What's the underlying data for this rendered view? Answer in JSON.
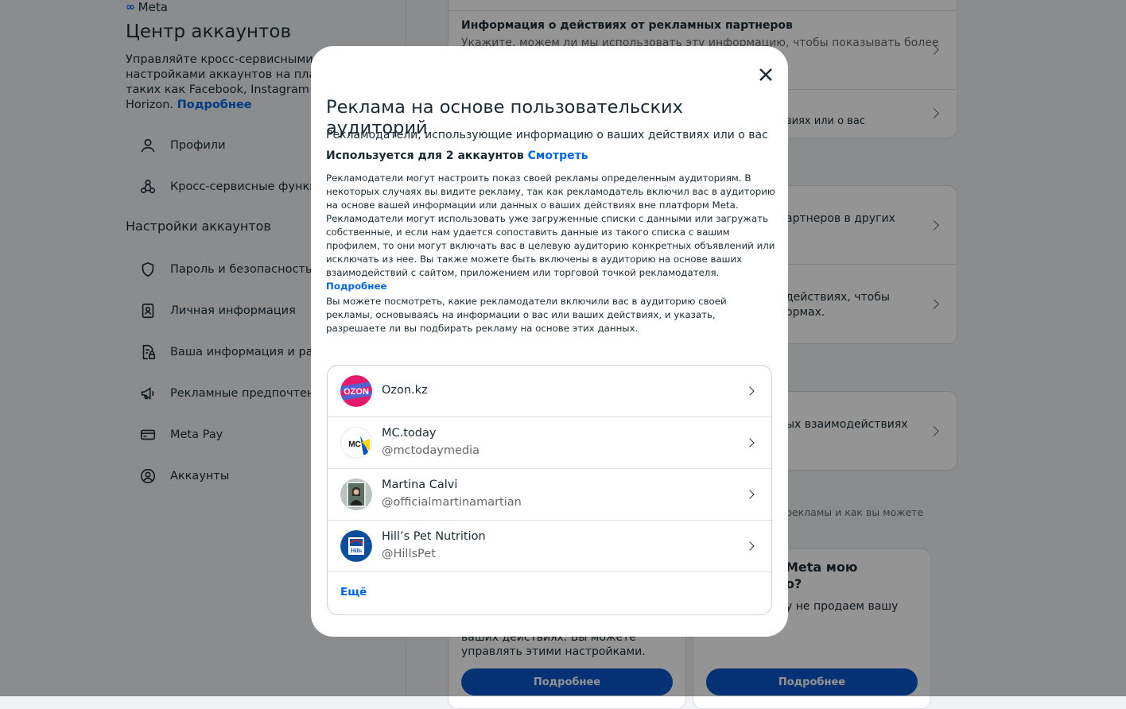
{
  "brand": {
    "name": "Meta"
  },
  "sidebar": {
    "title": "Центр аккаунтов",
    "description": "Управляйте кросс-сервисными фу\nнастройками аккаунтов на платфо\nтаких как Facebook, Instagram и\nHorizon.",
    "description_link": "Подробнее",
    "items_top": [
      {
        "label": "Профили",
        "icon": "person-icon"
      },
      {
        "label": "Кросс-сервисные функц",
        "icon": "connected-experiences-icon"
      }
    ],
    "section_title": "Настройки аккаунтов",
    "items": [
      {
        "label": "Пароль и безопасность",
        "icon": "shield-icon"
      },
      {
        "label": "Личная информация",
        "icon": "id-card-icon"
      },
      {
        "label": "Ваша информация и разр",
        "icon": "document-lock-icon"
      },
      {
        "label": "Рекламные предпочтени",
        "icon": "megaphone-icon"
      },
      {
        "label": "Meta Pay",
        "icon": "credit-card-icon"
      },
      {
        "label": "Аккаунты",
        "icon": "account-circle-icon"
      }
    ]
  },
  "background": {
    "card1_title": "Информация о действиях от рекламных партнеров",
    "card1_sub": "Укажите, можем ли мы использовать эту информацию, чтобы показывать более",
    "card1_row2": "виях или о вас",
    "card2_row1": "артнеров в других",
    "card2_row2a": "действиях, чтобы",
    "card2_row2b": "ормах.",
    "card3_row1": "ых взаимодействиях",
    "caption": "рекламы и как вы можете",
    "card4_title_a": "Meta мою",
    "card4_title_b": "о?",
    "card4_sub": "у не продаем вашу",
    "card5_text_a": "ваших действиях. Вы можете",
    "card5_text_b": "управлять этими настройками.",
    "btn1": "Подробнее",
    "btn2": "Подробнее"
  },
  "modal": {
    "title": "Реклама на основе пользовательских аудиторий",
    "subtitle": "Рекламодатели, использующие информацию о ваших действиях или о вас",
    "used_for": "Используется для 2 аккаунтов",
    "used_link": "Смотреть",
    "paragraph1": "Рекламодатели могут настроить показ своей рекламы определенным аудиториям. В некоторых случаях вы видите рекламу, так как рекламодатель включил вас в аудиторию на основе вашей информации или данных о ваших действиях вне платформ Meta. Рекламодатели могут использовать уже загруженные списки с данными или загружать собственные, и если нам удается сопоставить данные из такого списка с вашим профилем, то они могут включать вас в целевую аудиторию конкретных объявлений или исключать из нее. Вы также можете быть включены в аудиторию на основе ваших взаимодействий с сайтом, приложением или торговой точкой рекламодателя.",
    "paragraph1_link": "Подробнее",
    "paragraph2": "Вы можете посмотреть, какие рекламодатели включили вас в аудиторию своей рекламы, основываясь на информации о вас или ваших действиях, и указать, разрешаете ли вы подбирать рекламу на основе этих данных.",
    "advertisers": [
      {
        "name": "Ozon.kz",
        "handle": ""
      },
      {
        "name": "MC.today",
        "handle": "@mctodaymedia"
      },
      {
        "name": "Martina Calvi",
        "handle": "@officialmartinamartian"
      },
      {
        "name": "Hill’s Pet Nutrition",
        "handle": "@HillsPet"
      }
    ],
    "more_label": "Ещё",
    "logo_texts": {
      "ozon": "OZON",
      "mc": "MC",
      "hills": "Hills"
    }
  },
  "colors": {
    "accent": "#0064e0",
    "button": "#0a56c9",
    "overlay": "rgba(0,0,0,0.42)"
  }
}
